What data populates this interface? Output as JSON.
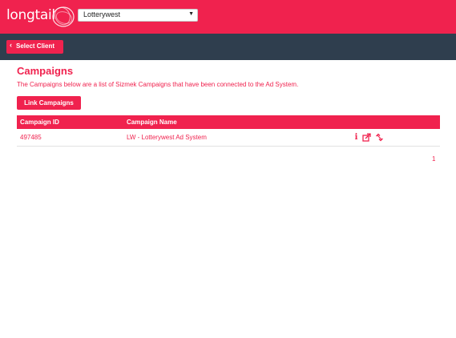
{
  "brand": {
    "logo_text": "longtail",
    "accent_color": "#f0224e",
    "subbar_color": "#2f3e4e"
  },
  "header": {
    "client_select": {
      "selected": "Lotterywest"
    }
  },
  "subbar": {
    "select_client_label": "Select Client"
  },
  "main": {
    "title": "Campaigns",
    "description": "The Campaigns below are a list of Sizmek Campaigns that have been connected to the Ad System.",
    "link_button_label": "Link Campaigns",
    "table": {
      "columns": [
        "Campaign ID",
        "Campaign Name"
      ],
      "rows": [
        {
          "id": "497485",
          "name": "LW - Lotterywest Ad System",
          "actions": [
            "info-icon",
            "share-icon",
            "unlink-icon"
          ]
        }
      ]
    },
    "pagination": {
      "current_page": "1"
    }
  }
}
